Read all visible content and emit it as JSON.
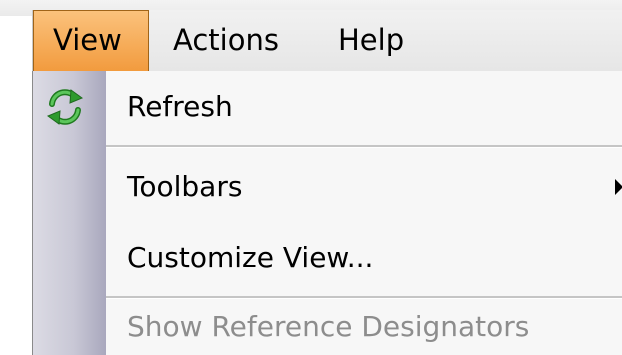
{
  "menubar": {
    "items": [
      {
        "label": "View",
        "active": true
      },
      {
        "label": "Actions",
        "active": false
      },
      {
        "label": "Help",
        "active": false
      }
    ]
  },
  "dropdown": {
    "items": [
      {
        "label": "Refresh",
        "icon": "refresh-icon",
        "enabled": true
      },
      {
        "label": "Toolbars",
        "has_submenu": true,
        "enabled": true
      },
      {
        "label": "Customize View...",
        "enabled": true
      },
      {
        "label": "Show Reference Designators",
        "enabled": false
      }
    ]
  },
  "colors": {
    "menu_highlight": "#f29b3e",
    "refresh_icon": "#2e9a2e",
    "disabled_text": "#8d8d8d"
  }
}
